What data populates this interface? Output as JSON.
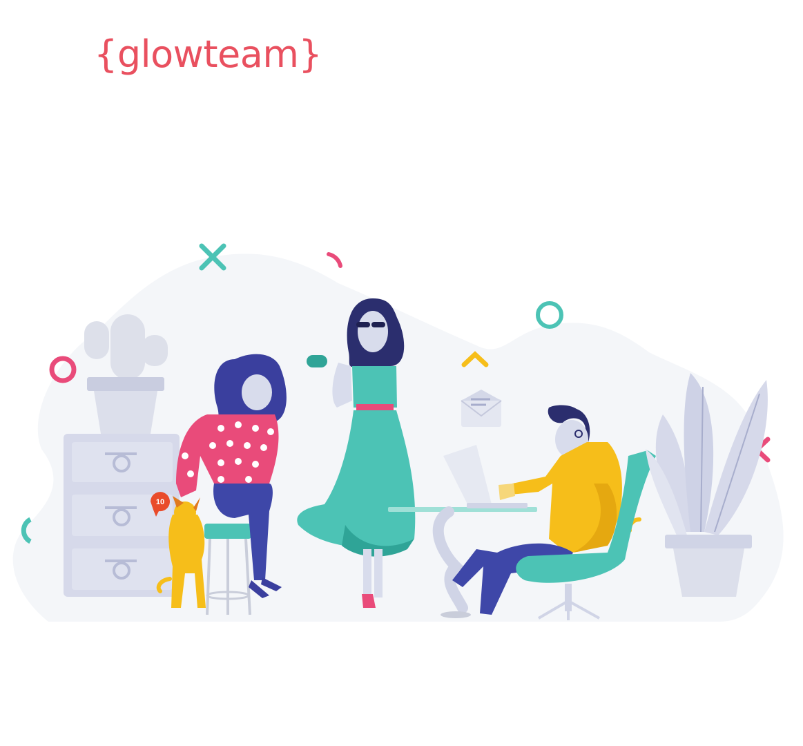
{
  "logo": {
    "text": "{glowteam}"
  },
  "illustration": {
    "notification_count": "10",
    "icons": [
      "cactus-icon",
      "dresser-icon",
      "dog-icon",
      "notification-badge-icon",
      "coffee-cup-icon",
      "envelope-icon",
      "laptop-icon",
      "office-chair-icon",
      "potted-plant-icon"
    ]
  },
  "colors": {
    "brand": "#E9505F",
    "teal": "#4CC3B5",
    "pink": "#E94B7A",
    "yellow": "#F6BE1A",
    "navy": "#2B2E6E",
    "blob": "#F4F6F9",
    "lavender": "#D8DCEC"
  }
}
